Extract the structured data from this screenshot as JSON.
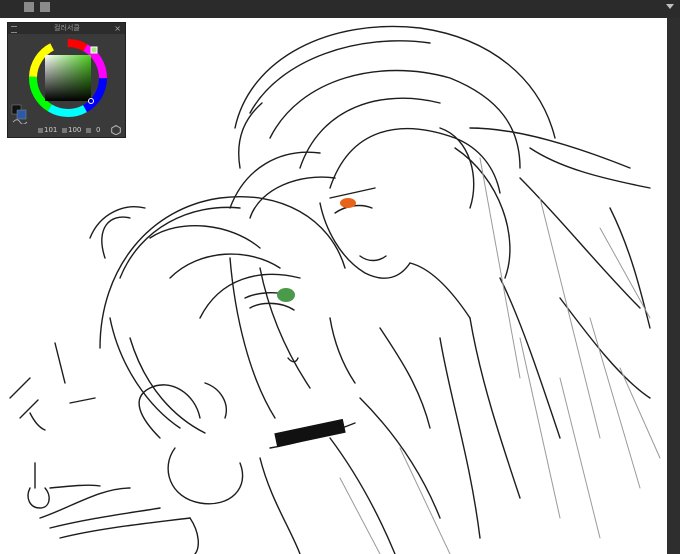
{
  "panel": {
    "title": "컬러서클",
    "close_glyph": "×",
    "values": {
      "h": "101",
      "s": "100",
      "v": "0"
    }
  },
  "colors": {
    "main": "#111111",
    "sub": "#2b5aa8",
    "hue_box": "#5fbf3f"
  },
  "icons": {
    "app_buttons": [
      "window-icon",
      "layout-icon"
    ],
    "panel_menu": "menu-icon",
    "panel_close": "close-icon",
    "panel_extra": "settings-hex-icon"
  }
}
